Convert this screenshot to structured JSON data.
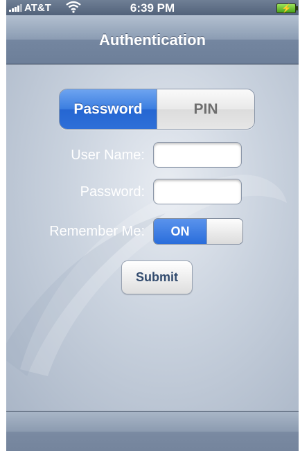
{
  "status_bar": {
    "carrier": "AT&T",
    "time": "6:39 PM"
  },
  "nav_bar": {
    "title": "Authentication"
  },
  "segmented_control": {
    "selected": "Password",
    "options": [
      "Password",
      "PIN"
    ]
  },
  "form": {
    "username_label": "User Name:",
    "username_value": "",
    "password_label": "Password:",
    "password_value": "",
    "remember_label": "Remember Me:",
    "remember_toggle_text": "ON",
    "submit_label": "Submit"
  },
  "colors": {
    "accent_blue": "#2e6fd8",
    "nav_bar": "#8b9cb3",
    "battery_green": "#6cc43a"
  },
  "icons": [
    "signal-bars-icon",
    "wifi-icon",
    "battery-icon"
  ]
}
